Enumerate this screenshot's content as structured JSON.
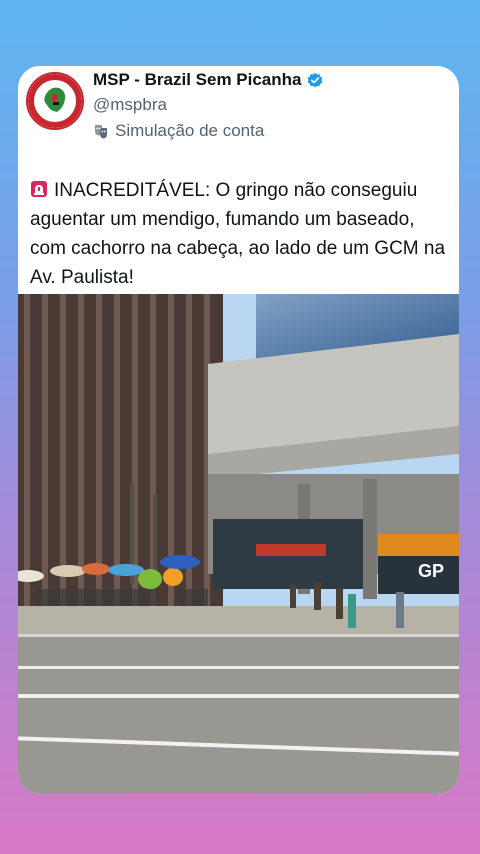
{
  "account": {
    "display_name": "MSP - Brazil Sem Picanha",
    "handle": "@mspbra",
    "simulation_label": "Simulação de conta",
    "icons": {
      "verified": "verified-badge-icon",
      "simulation": "theater-masks-icon",
      "avatar": "msp-logo"
    },
    "colors": {
      "verified": "#1d9bf0",
      "logo_red": "#c8262f",
      "logo_green": "#2e8b3a"
    }
  },
  "post": {
    "siren_icon": "siren-emoji-icon",
    "text": "INACREDITÁVEL: O gringo não conseguiu aguentar um mendigo,  fumando um baseado, com cachorro na cabeça, ao lado de um GCM na Av. Paulista!"
  },
  "media": {
    "description_icon": "street-photo",
    "store_sign_text": "GP"
  }
}
